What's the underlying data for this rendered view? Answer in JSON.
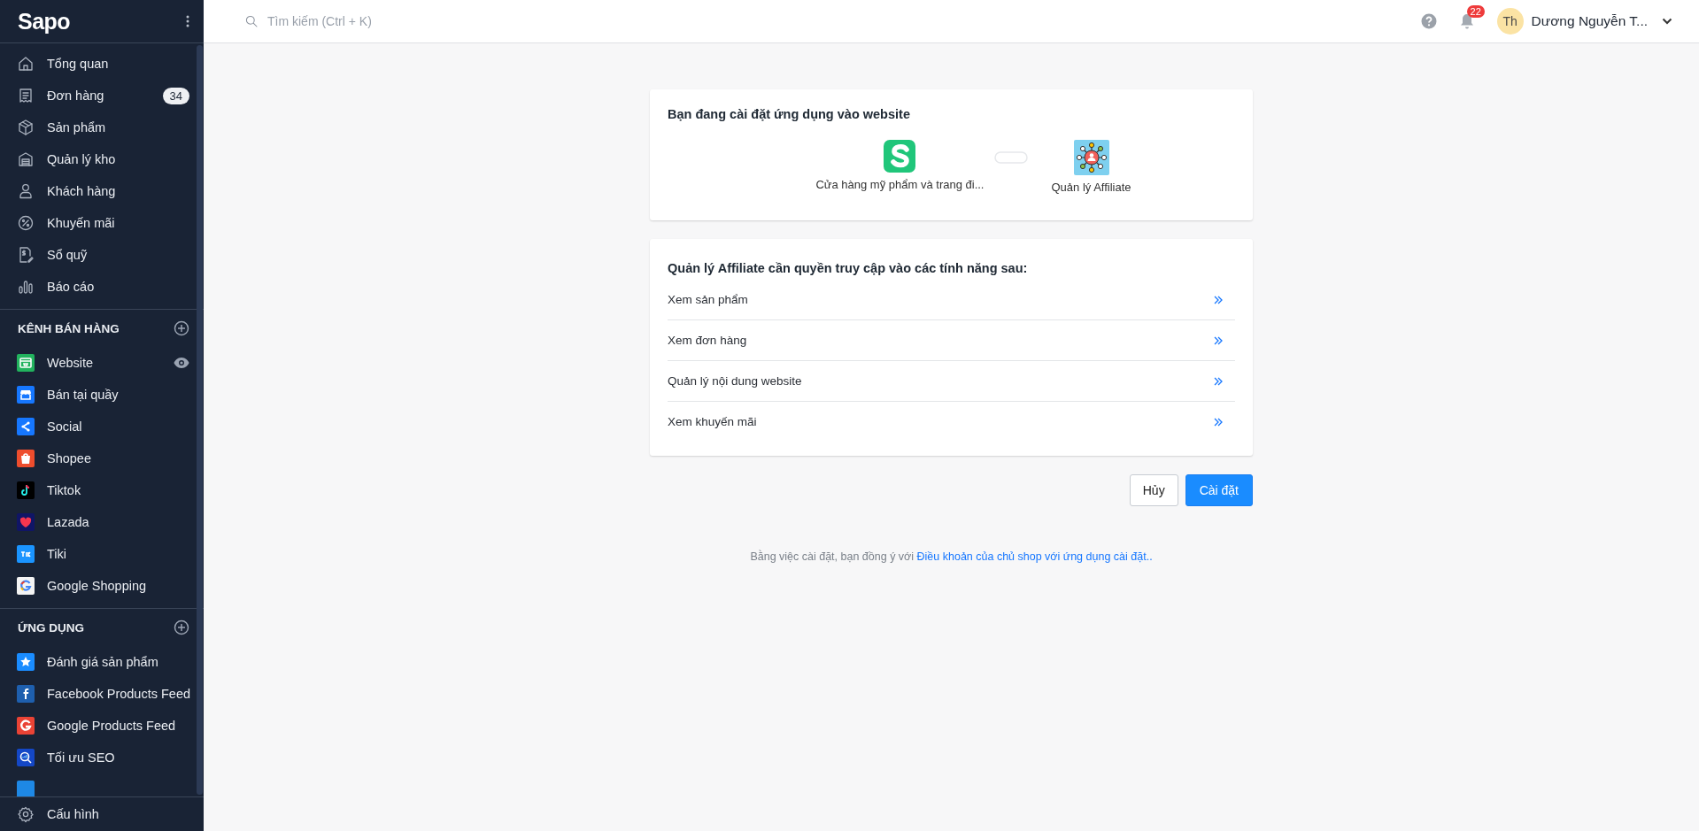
{
  "sidebar": {
    "logo": "Sapo",
    "main_menu": [
      {
        "label": "Tổng quan"
      },
      {
        "label": "Đơn hàng",
        "badge": "34"
      },
      {
        "label": "Sản phẩm"
      },
      {
        "label": "Quản lý kho"
      },
      {
        "label": "Khách hàng"
      },
      {
        "label": "Khuyến mãi"
      },
      {
        "label": "Sổ quỹ"
      },
      {
        "label": "Báo cáo"
      }
    ],
    "sales_channels": {
      "title": "KÊNH BÁN HÀNG",
      "items": [
        {
          "label": "Website",
          "color": "#22b35e",
          "kind": "preview"
        },
        {
          "label": "Bán tại quầy",
          "color": "#1677ff",
          "kind": "plain"
        },
        {
          "label": "Social",
          "color": "#1677ff",
          "kind": "plain"
        },
        {
          "label": "Shopee",
          "color": "#ee4d2d",
          "kind": "plain"
        },
        {
          "label": "Tiktok",
          "color": "#000000",
          "kind": "plain"
        },
        {
          "label": "Lazada",
          "color": "#101566",
          "kind": "plain"
        },
        {
          "label": "Tiki",
          "color": "#1a94ff",
          "kind": "plain"
        },
        {
          "label": "Google Shopping",
          "color": "#f4f4f4",
          "kind": "plain"
        }
      ]
    },
    "apps": {
      "title": "ỨNG DỤNG",
      "items": [
        {
          "label": "Đánh giá sản phẩm",
          "color": "#1a8cff"
        },
        {
          "label": "Facebook Products Feed",
          "color": "#1e5fae"
        },
        {
          "label": "Google Products Feed",
          "color": "#ea4335"
        },
        {
          "label": "Tối ưu SEO",
          "color": "#1447c6"
        },
        {
          "color": "#1e88e5"
        }
      ]
    },
    "settings": {
      "label": "Cấu hình"
    }
  },
  "topbar": {
    "search": {
      "placeholder": "Tìm kiếm (Ctrl + K)"
    },
    "notifications": {
      "count": "22"
    },
    "user": {
      "initials": "Th",
      "name": "Dương Nguyễn T..."
    }
  },
  "install_card": {
    "title": "Bạn đang cài đặt ứng dụng vào website",
    "source": {
      "name": "Cửa hàng mỹ phẩm và trang đi..."
    },
    "target": {
      "name": "Quản lý Affiliate"
    }
  },
  "permissions_card": {
    "title": "Quản lý Affiliate cần quyền truy cập vào các tính năng sau:",
    "items": [
      {
        "label": "Xem sản phẩm"
      },
      {
        "label": "Xem đơn hàng"
      },
      {
        "label": "Quản lý nội dung website"
      },
      {
        "label": "Xem khuyến mãi"
      }
    ]
  },
  "buttons": [
    {
      "label": "Hủy",
      "kind": "secondary"
    },
    {
      "label": "Cài đặt",
      "kind": "primary"
    }
  ],
  "terms": {
    "text": "Bằng việc cài đặt, bạn đồng ý với",
    "link": "Điều khoản của chủ shop với ứng dụng cài đặt.."
  }
}
